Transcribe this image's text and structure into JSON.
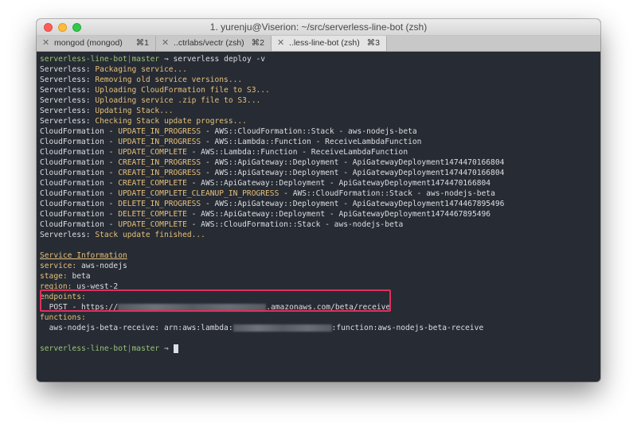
{
  "window": {
    "title": "1. yurenju@Viserion: ~/src/serverless-line-bot (zsh)"
  },
  "tabs": [
    {
      "label": "mongod (mongod)",
      "shortcut": "⌘1",
      "active": false
    },
    {
      "label": "..ctrlabs/vectr (zsh)",
      "shortcut": "⌘2",
      "active": false
    },
    {
      "label": "..less-line-bot (zsh)",
      "shortcut": "⌘3",
      "active": true
    }
  ],
  "prompt": {
    "dir": "serverless-line-bot",
    "sep": "|",
    "branch": "master",
    "arrow": "⇒",
    "command": "serverless deploy -v"
  },
  "serverless_log": [
    {
      "prefix": "Serverless:",
      "msg": "Packaging service..."
    },
    {
      "prefix": "Serverless:",
      "msg": "Removing old service versions..."
    },
    {
      "prefix": "Serverless:",
      "msg": "Uploading CloudFormation file to S3..."
    },
    {
      "prefix": "Serverless:",
      "msg": "Uploading service .zip file to S3..."
    },
    {
      "prefix": "Serverless:",
      "msg": "Updating Stack..."
    },
    {
      "prefix": "Serverless:",
      "msg": "Checking Stack update progress..."
    }
  ],
  "cf_log": [
    {
      "status": "UPDATE_IN_PROGRESS",
      "rest": "AWS::CloudFormation::Stack - aws-nodejs-beta"
    },
    {
      "status": "UPDATE_IN_PROGRESS",
      "rest": "AWS::Lambda::Function - ReceiveLambdaFunction"
    },
    {
      "status": "UPDATE_COMPLETE",
      "rest": "AWS::Lambda::Function - ReceiveLambdaFunction"
    },
    {
      "status": "CREATE_IN_PROGRESS",
      "rest": "AWS::ApiGateway::Deployment - ApiGatewayDeployment1474470166804"
    },
    {
      "status": "CREATE_IN_PROGRESS",
      "rest": "AWS::ApiGateway::Deployment - ApiGatewayDeployment1474470166804"
    },
    {
      "status": "CREATE_COMPLETE",
      "rest": "AWS::ApiGateway::Deployment - ApiGatewayDeployment1474470166804"
    },
    {
      "status": "UPDATE_COMPLETE_CLEANUP_IN_PROGRESS",
      "rest": "AWS::CloudFormation::Stack - aws-nodejs-beta"
    },
    {
      "status": "DELETE_IN_PROGRESS",
      "rest": "AWS::ApiGateway::Deployment - ApiGatewayDeployment1474467895496"
    },
    {
      "status": "DELETE_COMPLETE",
      "rest": "AWS::ApiGateway::Deployment - ApiGatewayDeployment1474467895496"
    },
    {
      "status": "UPDATE_COMPLETE",
      "rest": "AWS::CloudFormation::Stack - aws-nodejs-beta"
    }
  ],
  "cf_prefix": "CloudFormation",
  "dash": " - ",
  "finished": {
    "prefix": "Serverless:",
    "msg": "Stack update finished..."
  },
  "service_info": {
    "heading": "Service Information",
    "service_key": "service:",
    "service_val": "aws-nodejs",
    "stage_key": "stage:",
    "stage_val": "beta",
    "region_key": "region:",
    "region_val": "us-west-2",
    "endpoints_key": "endpoints:",
    "endpoint_method": "POST",
    "endpoint_prefix": "https://",
    "endpoint_suffix": ".amazonaws.com/beta/receive",
    "functions_key": "functions:",
    "function_name": "aws-nodejs-beta-receive:",
    "function_arn_prefix": "arn:aws:lambda:",
    "function_arn_suffix": ":function:aws-nodejs-beta-receive"
  },
  "colors": {
    "terminal_bg": "#272b33",
    "green": "#98c379",
    "yellow": "#e5c07b",
    "highlight_border": "#e0305e"
  }
}
